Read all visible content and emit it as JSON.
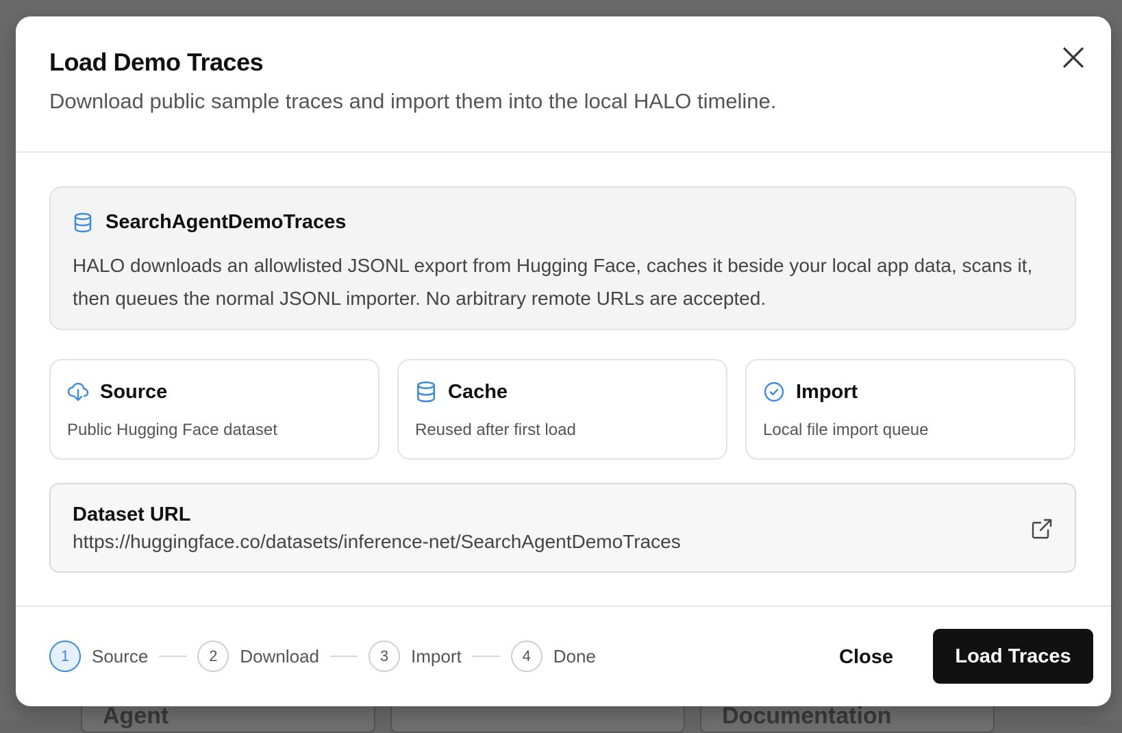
{
  "background": {
    "cards": [
      "Agent",
      "Documentation"
    ]
  },
  "modal": {
    "title": "Load Demo Traces",
    "subtitle": "Download public sample traces and import them into the local HALO timeline.",
    "close_icon": "close-icon"
  },
  "info": {
    "icon": "database-icon",
    "title": "SearchAgentDemoTraces",
    "description": "HALO downloads an allowlisted JSONL export from Hugging Face, caches it beside your local app data, scans it, then queues the normal JSONL importer. No arbitrary remote URLs are accepted."
  },
  "cards": [
    {
      "icon": "cloud-download-icon",
      "label": "Source",
      "desc": "Public Hugging Face dataset"
    },
    {
      "icon": "database-icon",
      "label": "Cache",
      "desc": "Reused after first load"
    },
    {
      "icon": "check-circle-icon",
      "label": "Import",
      "desc": "Local file import queue"
    }
  ],
  "dataset": {
    "label": "Dataset URL",
    "url": "https://huggingface.co/datasets/inference-net/SearchAgentDemoTraces",
    "open_icon": "external-link-icon"
  },
  "stepper": [
    {
      "num": "1",
      "name": "Source",
      "active": true
    },
    {
      "num": "2",
      "name": "Download",
      "active": false
    },
    {
      "num": "3",
      "name": "Import",
      "active": false
    },
    {
      "num": "4",
      "name": "Done",
      "active": false
    }
  ],
  "footer": {
    "close_label": "Close",
    "load_label": "Load Traces"
  },
  "colors": {
    "accent": "#3b8be0",
    "primary_button": "#111111",
    "overlay": "#6a6a6a"
  }
}
